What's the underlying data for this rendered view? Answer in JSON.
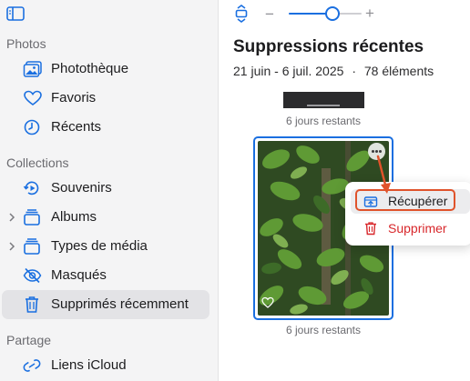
{
  "sidebar": {
    "sections": {
      "photos": "Photos",
      "collections": "Collections",
      "sharing": "Partage"
    },
    "items": [
      {
        "label": "Photothèque",
        "icon": "photo-library-icon"
      },
      {
        "label": "Favoris",
        "icon": "heart-icon"
      },
      {
        "label": "Récents",
        "icon": "clock-icon"
      },
      {
        "label": "Souvenirs",
        "icon": "memories-icon"
      },
      {
        "label": "Albums",
        "icon": "albums-icon"
      },
      {
        "label": "Types de média",
        "icon": "media-types-icon"
      },
      {
        "label": "Masqués",
        "icon": "eye-slash-icon"
      },
      {
        "label": "Supprimés récemment",
        "icon": "trash-icon",
        "selected": true
      },
      {
        "label": "Liens iCloud",
        "icon": "link-icon"
      }
    ]
  },
  "main": {
    "title": "Suppressions récentes",
    "date_range": "21 juin - 6 juil. 2025",
    "separator": "·",
    "count": "78 éléments",
    "photos": [
      {
        "days_left": "6 jours restants"
      },
      {
        "days_left": "6 jours restants"
      }
    ],
    "zoom_level": 0.62
  },
  "context_menu": {
    "recover": "Récupérer",
    "delete": "Supprimer"
  },
  "colors": {
    "accent": "#1a6fe0",
    "destructive": "#d8272b",
    "annotation": "#e0532b",
    "sidebar_bg": "#f4f4f5"
  }
}
